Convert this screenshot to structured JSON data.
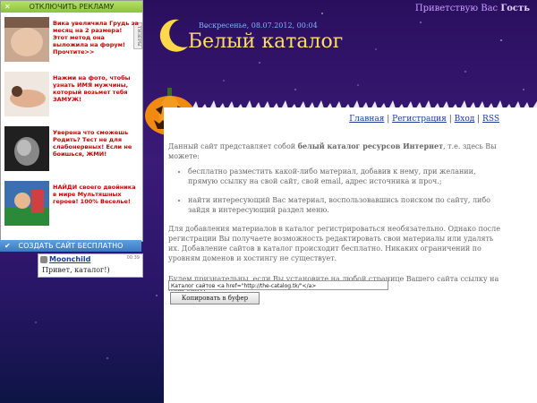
{
  "greeting": {
    "prefix": "Приветствую Вас",
    "name": "Гость"
  },
  "header": {
    "date": "Воскресенье, 08.07.2012, 00:04",
    "title": "Белый каталог"
  },
  "ad_panel": {
    "disable_label": "ОТКЛЮЧИТЬ РЕКЛАМУ",
    "side_label": "ТИЗЕРЫ",
    "items": [
      {
        "text": "Вика увеличила Грудь за месяц на 2 размера! Этот метод она выложила на форум! Прочтите>>"
      },
      {
        "text": "Нажми на фото, чтобы узнать ИМЯ мужчины, который возьмет тебя ЗАМУЖ!"
      },
      {
        "text": "Уверена что сможешь Родить? Тест не для слабонервных! Если не боишься, ЖМИ!"
      },
      {
        "text": "НАЙДИ своего двойника в мире Мультяшных героев! 100% Весельe!"
      }
    ],
    "create_site_label": "СОЗДАТЬ САЙТ БЕСПЛАТНО"
  },
  "chat": {
    "user": "Moonchild",
    "time": "00:39",
    "message": "Привет, каталог!)"
  },
  "nav": {
    "home": "Главная",
    "register": "Регистрация",
    "login": "Вход",
    "rss": "RSS"
  },
  "content": {
    "intro_before": "Данный сайт представляет собой ",
    "intro_bold": "белый каталог ресурсов Интернет",
    "intro_after": ", т.е. здесь Вы можете:",
    "bullet1": "бесплатно разместить какой-либо материал, добавив к нему, при желании, прямую ссылку на свой сайт, свой email, адрес источника и проч.;",
    "bullet2": "найти интересующий Вас материал, воспользовавшись поиском по сайту, либо зайдя в интересующий раздел меню.",
    "para2": "Для добавления материалов в каталог регистрироваться необязательно. Однако после регистрации Вы получаете возможность редактировать свои материалы или удалять их. Добавление сайтов в каталог происходит бесплатно. Никаких ограничений по уровням доменов и хостингу не существует.",
    "para3": "Будем признательны, если Вы установите на любой странице Вашего сайта ссылку на наш сайт:",
    "code_value": "Каталог сайтов <a href=\"http://the-catalog.tk/\"</a>",
    "copy_label": "Копировать в буфер"
  },
  "colors": {
    "title": "#ffdc6a",
    "link": "#1a3c9a",
    "ad_text": "#cc0000",
    "bg": "#2a0f5e"
  }
}
